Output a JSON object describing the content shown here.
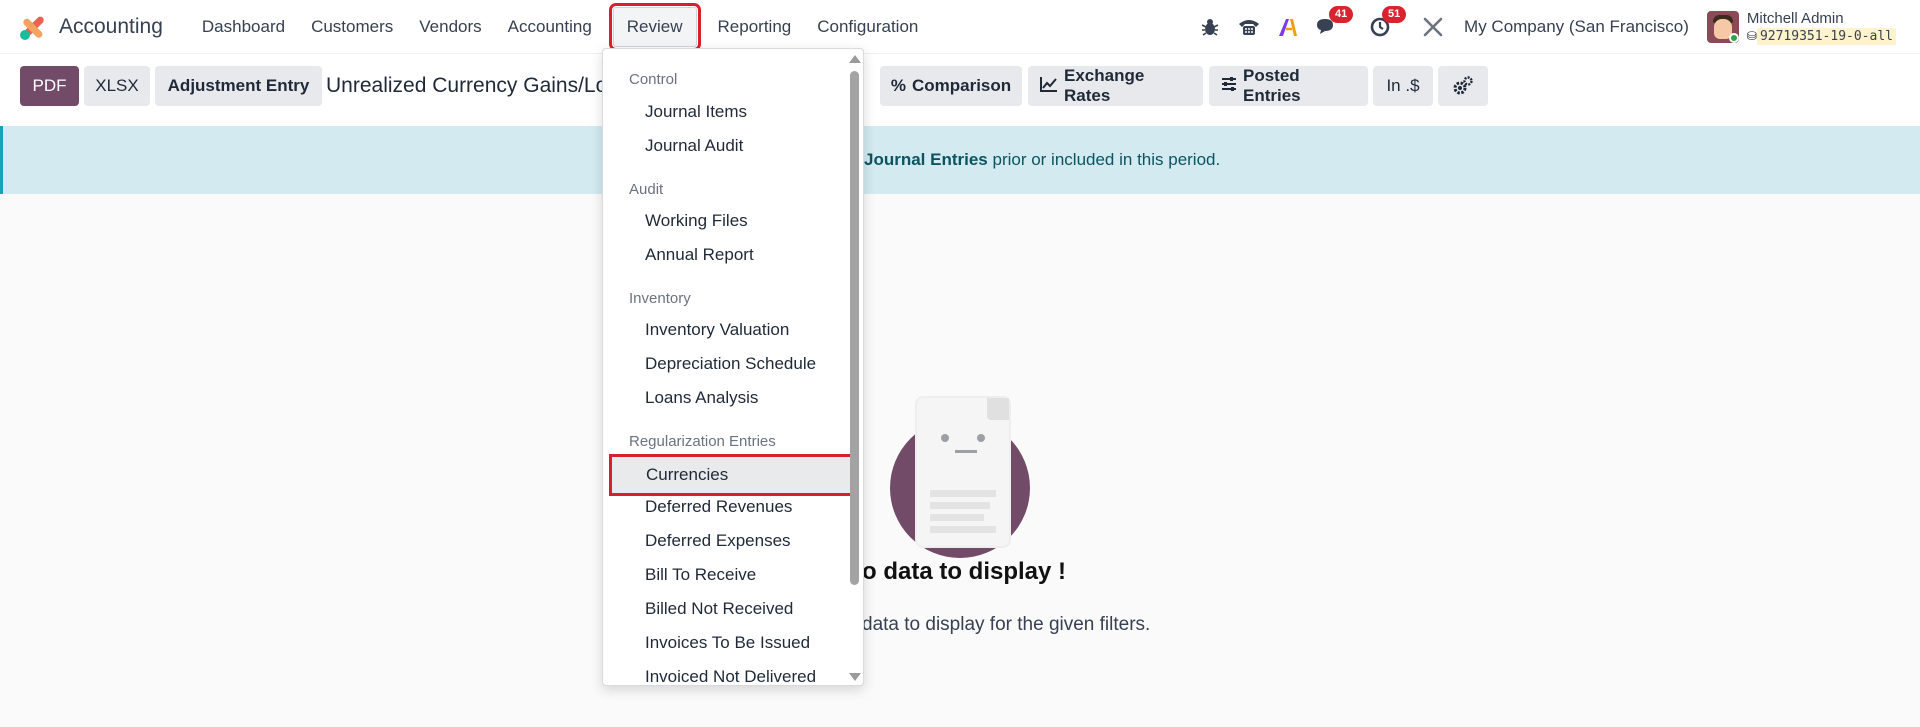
{
  "navbar": {
    "app_name": "Accounting",
    "menu": [
      "Dashboard",
      "Customers",
      "Vendors",
      "Accounting",
      "Review",
      "Reporting",
      "Configuration"
    ],
    "active_menu": "Review",
    "messages_count": "41",
    "activities_count": "51",
    "company": "My Company (San Francisco)",
    "user_name": "Mitchell Admin",
    "database": "92719351-19-0-all"
  },
  "control_panel": {
    "pdf_label": "PDF",
    "xlsx_label": "XLSX",
    "adjustment_label": "Adjustment Entry",
    "report_title": "Unrealized Currency Gains/Losses",
    "comparison_label": "Comparison",
    "exchange_rates_label": "Exchange Rates",
    "posted_entries_label": "Posted Entries",
    "currency_label": "In .$"
  },
  "banner": {
    "bold_text": "Journal Entries",
    "rest_text": " prior or included in this period."
  },
  "empty_state": {
    "title": "o data to display !",
    "subtitle": "data to display for the given filters."
  },
  "dropdown": {
    "sections": [
      {
        "title": "Control",
        "items": [
          "Journal Items",
          "Journal Audit"
        ]
      },
      {
        "title": "Audit",
        "items": [
          "Working Files",
          "Annual Report"
        ]
      },
      {
        "title": "Inventory",
        "items": [
          "Inventory Valuation",
          "Depreciation Schedule",
          "Loans Analysis"
        ]
      },
      {
        "title": "Regularization Entries",
        "items": [
          "Currencies",
          "Deferred Revenues",
          "Deferred Expenses",
          "Bill To Receive",
          "Billed Not Received",
          "Invoices To Be Issued",
          "Invoiced Not Delivered"
        ]
      }
    ],
    "highlighted_item": "Currencies"
  },
  "colors": {
    "brand": "#714b67",
    "highlight_border": "#d7212a",
    "banner_bg": "#d2eaf0",
    "badge": "#d9232e"
  },
  "icons": [
    "bug-icon",
    "phone-icon",
    "ai-icon",
    "chat-icon",
    "clock-icon",
    "tools-icon",
    "percent-icon",
    "chart-line-icon",
    "sliders-icon",
    "gears-icon",
    "database-icon"
  ]
}
